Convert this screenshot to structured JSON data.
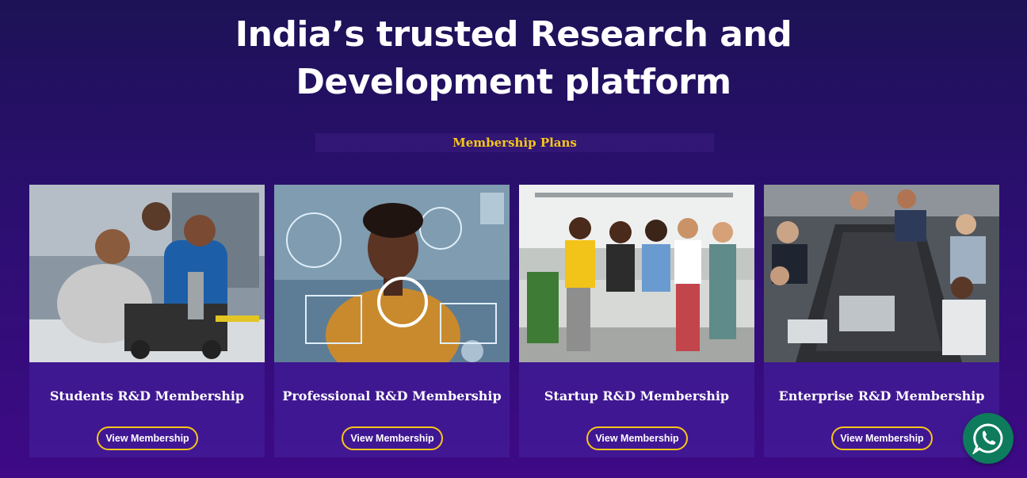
{
  "hero": {
    "title_line1": "India’s trusted Research and",
    "title_line2": "Development platform"
  },
  "section": {
    "label": "Membership Plans"
  },
  "cards": [
    {
      "title": "Students R&D Membership",
      "button": "View Membership",
      "image": "students-lab-robotics-photo"
    },
    {
      "title": "Professional R&D Membership",
      "button": "View Membership",
      "image": "woman-holographic-interface-photo"
    },
    {
      "title": "Startup R&D Membership",
      "button": "View Membership",
      "image": "startup-team-office-photo"
    },
    {
      "title": "Enterprise R&D Membership",
      "button": "View Membership",
      "image": "boardroom-meeting-photo"
    }
  ],
  "floating": {
    "icon": "whatsapp-icon"
  },
  "colors": {
    "accent": "#f6c61a",
    "background": "#2a0f6e",
    "whatsapp": "#0d7b5c"
  }
}
